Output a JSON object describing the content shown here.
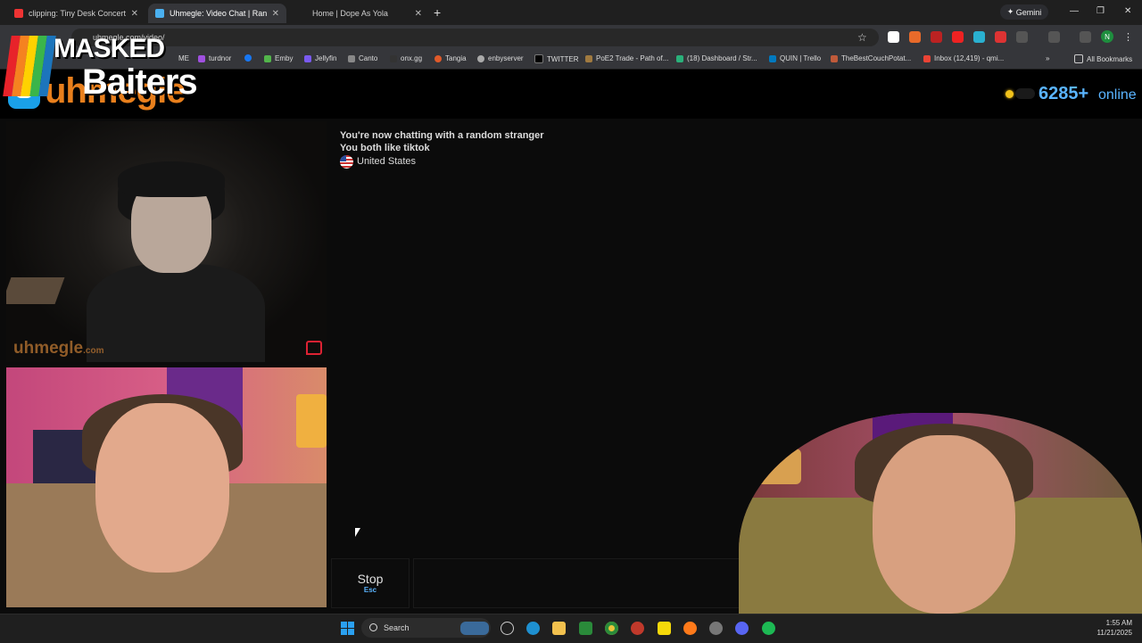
{
  "browser": {
    "tabs": [
      {
        "title": "clipping: Tiny Desk Concert - Y",
        "active": false
      },
      {
        "title": "Uhmegle: Video Chat | Ran",
        "active": true
      },
      {
        "title": "Home | Dope As Yola",
        "active": false
      }
    ],
    "gemini_label": "Gemini",
    "url": "uhmegle.com/video/",
    "bookmarks": [
      "ME",
      "turdnor",
      "Emby",
      "Jellyfin",
      "Canto",
      "onx.gg",
      "Tangia",
      "enbyserver",
      "TWITTER",
      "PoE2 Trade - Path of...",
      "(18) Dashboard / Str...",
      "QUIN | Trello",
      "TheBestCouchPotat...",
      "Inbox (12,419) - qmi..."
    ],
    "all_bookmarks": "All Bookmarks",
    "profile_initial": "N"
  },
  "site": {
    "logo_text": "uhmegle",
    "online_count": "6285+",
    "online_label": "online",
    "watermark": "uhmegle",
    "watermark_suffix": ".com"
  },
  "chat": {
    "lines": [
      "You're now chatting with a random stranger",
      "You both like tiktok"
    ],
    "country": "United States",
    "stop_label": "Stop",
    "stop_key": "Esc"
  },
  "overlay": {
    "brand_line1": "MASKED",
    "brand_line2": "Baiters",
    "stripe_colors": [
      "#e8232a",
      "#f58220",
      "#ffd200",
      "#3ab54a",
      "#1c75bc",
      "#6a3d9a"
    ]
  },
  "taskbar": {
    "search_label": "Search",
    "time": "1:55 AM",
    "date": "11/21/2025"
  }
}
